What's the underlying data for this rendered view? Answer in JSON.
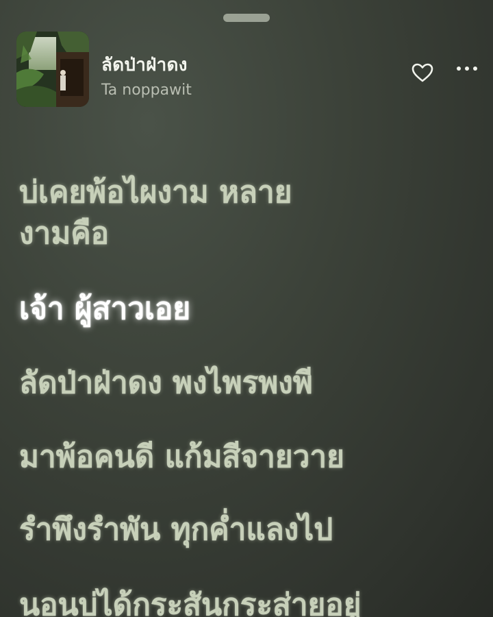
{
  "player": {
    "track_title": "ลัดป่าฝ่าดง",
    "artist": "Ta noppawit",
    "artwork_icon": "album-artwork",
    "like_icon": "heart-outline-icon",
    "more_icon": "ellipsis-icon"
  },
  "lyrics": {
    "lines": [
      "บ่เคยพ้อไผงาม หลาย",
      "งามคือ",
      "เจ้า ผู้สาวเอย",
      "ลัดป่าฝ่าดง พงไพรพงพี",
      "มาพ้อคนดี แก้มสีจายวาย",
      "รำพึงรำพัน ทุกค่ำแลงไป",
      "นอนบ่ได้กระสันกระส่ายอยู่"
    ],
    "active_index": 2
  },
  "colors": {
    "background": "#353a33",
    "lyric_inactive": "#c7d0b9",
    "lyric_active": "#ffffff",
    "title": "#f3f5ee",
    "artist": "#b9beb2"
  }
}
